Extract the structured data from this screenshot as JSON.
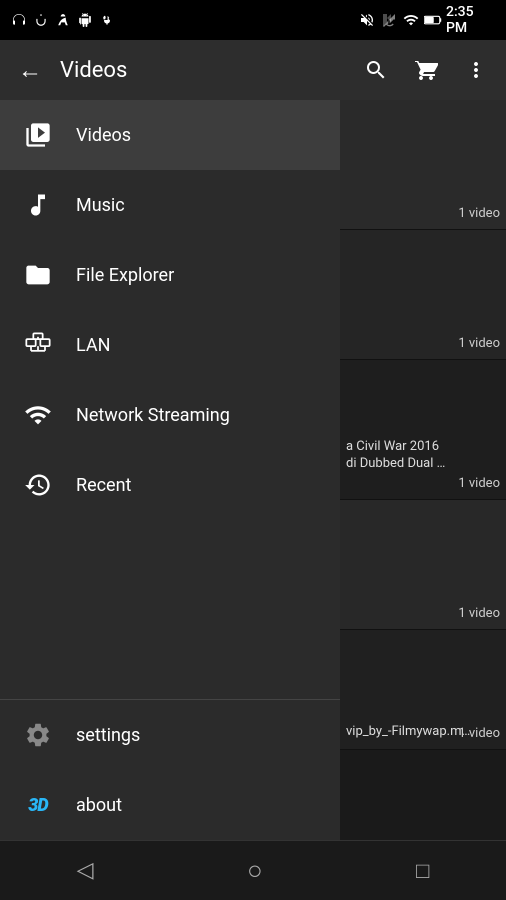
{
  "statusBar": {
    "time": "2:35 PM",
    "battery": "59%",
    "icons_left": [
      "headphone",
      "vibrate",
      "bag",
      "android",
      "usb"
    ],
    "icons_right": [
      "mute",
      "signal-off",
      "signal-bars",
      "battery"
    ]
  },
  "toolbar": {
    "back_label": "←",
    "title": "Videos",
    "search_icon": "search",
    "cart_icon": "cart",
    "more_icon": "more"
  },
  "drawer": {
    "items": [
      {
        "id": "videos",
        "label": "Videos",
        "icon": "video",
        "active": true
      },
      {
        "id": "music",
        "label": "Music",
        "icon": "music",
        "active": false
      },
      {
        "id": "file-explorer",
        "label": "File Explorer",
        "icon": "folder",
        "active": false
      },
      {
        "id": "lan",
        "label": "LAN",
        "icon": "lan",
        "active": false
      },
      {
        "id": "network-streaming",
        "label": "Network Streaming",
        "icon": "streaming",
        "active": false
      },
      {
        "id": "recent",
        "label": "Recent",
        "icon": "recent",
        "active": false
      }
    ],
    "bottom_items": [
      {
        "id": "settings",
        "label": "settings",
        "icon": "gear"
      },
      {
        "id": "about",
        "label": "about",
        "icon": "3d"
      }
    ]
  },
  "videoList": [
    {
      "id": 1,
      "count": "1 video",
      "text": ""
    },
    {
      "id": 2,
      "count": "1 video",
      "text": ""
    },
    {
      "id": 3,
      "count": "1 video",
      "text": "a Civil War 2016 di Dubbed Dual …"
    },
    {
      "id": 4,
      "count": "1 video",
      "text": ""
    },
    {
      "id": 5,
      "count": "1 video",
      "text": "vip_by_-Filmywap.m…"
    }
  ],
  "bottomNav": {
    "back": "◁",
    "home": "○",
    "recent": "□"
  }
}
